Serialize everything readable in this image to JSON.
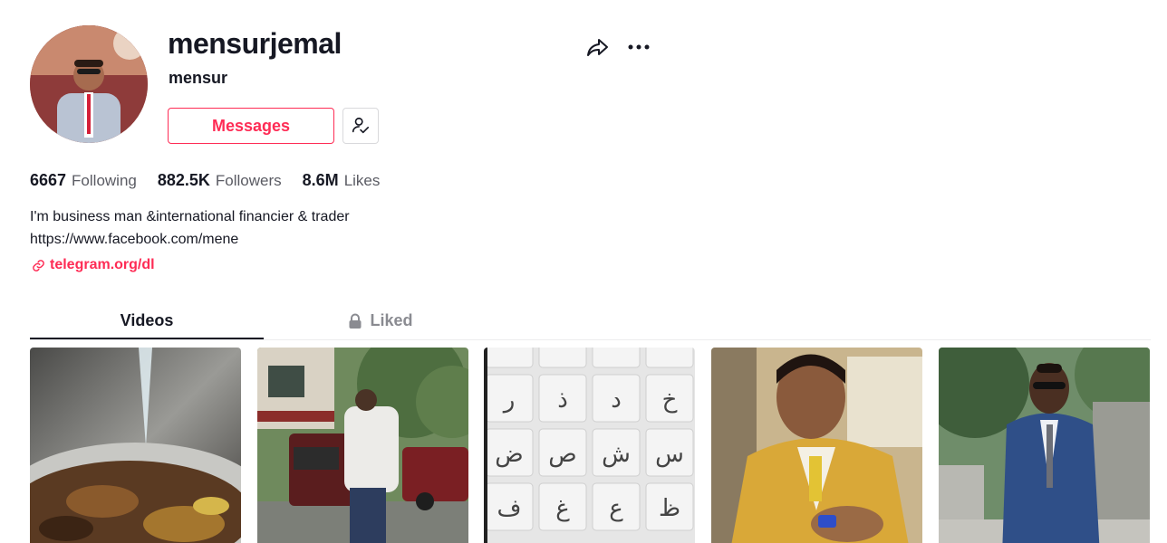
{
  "profile": {
    "username": "mensurjemal",
    "nickname": "mensur",
    "messages_label": "Messages"
  },
  "stats": {
    "following_count": "6667",
    "following_label": "Following",
    "followers_count": "882.5K",
    "followers_label": "Followers",
    "likes_count": "8.6M",
    "likes_label": "Likes"
  },
  "bio": {
    "line1": "I'm business man &international financier & trader",
    "line2": "https://www.facebook.com/mene",
    "link": "telegram.org/dl"
  },
  "tabs": [
    {
      "label": "Videos",
      "active": true
    },
    {
      "label": "Liked",
      "locked": true
    }
  ],
  "videos": [
    {
      "subject": "food-pot"
    },
    {
      "subject": "man-walking-street"
    },
    {
      "subject": "arabic-letters"
    },
    {
      "subject": "man-yellow-suit"
    },
    {
      "subject": "man-blue-suit"
    }
  ],
  "icons": [
    "share-icon",
    "more-icon",
    "friend-check-icon",
    "link-icon",
    "lock-icon"
  ],
  "colors": {
    "accent": "#fe2c55",
    "text": "#161823",
    "muted": "#5a5b63"
  }
}
